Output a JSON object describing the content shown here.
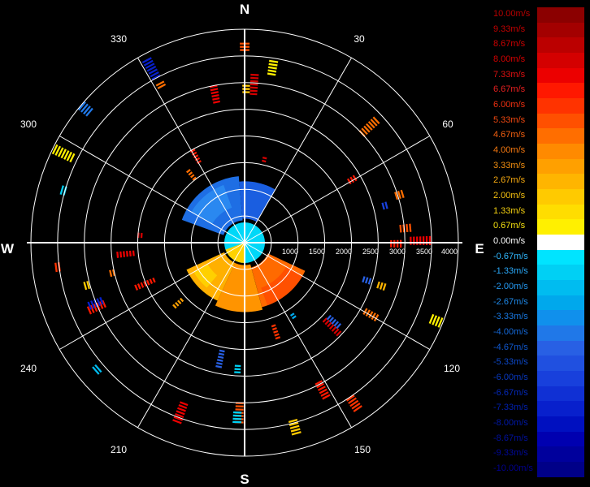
{
  "compass": {
    "north": "N",
    "south": "S",
    "east": "E",
    "west": "W"
  },
  "azimuth_labels": [
    "30",
    "60",
    "120",
    "150",
    "210",
    "240",
    "300",
    "330"
  ],
  "chart_data": {
    "type": "heatmap",
    "projection": "polar",
    "range_labels": [
      "1000",
      "1500",
      "2000",
      "2500",
      "3000",
      "3500",
      "4000"
    ],
    "range_max": 4000,
    "colorbar": {
      "labels": [
        "10.00m/s",
        "9.33m/s",
        "8.67m/s",
        "8.00m/s",
        "7.33m/s",
        "6.67m/s",
        "6.00m/s",
        "5.33m/s",
        "4.67m/s",
        "4.00m/s",
        "3.33m/s",
        "2.67m/s",
        "2.00m/s",
        "1.33m/s",
        "0.67m/s",
        "0.00m/s",
        "-0.67m/s",
        "-1.33m/s",
        "-2.00m/s",
        "-2.67m/s",
        "-3.33m/s",
        "-4.00m/s",
        "-4.67m/s",
        "-5.33m/s",
        "-6.00m/s",
        "-6.67m/s",
        "-7.33m/s",
        "-8.00m/s",
        "-8.67m/s",
        "-9.33m/s",
        "-10.00m/s"
      ],
      "colors": [
        "#8b0000",
        "#a30000",
        "#bb0000",
        "#d40000",
        "#ec0000",
        "#ff1800",
        "#ff3300",
        "#ff5000",
        "#ff6e00",
        "#ff8a00",
        "#ffa000",
        "#ffb500",
        "#ffca00",
        "#ffdd00",
        "#fff000",
        "#ffffff",
        "#00e4ff",
        "#00d0f4",
        "#00bcf0",
        "#00a8ec",
        "#1090ec",
        "#2078e8",
        "#2860e4",
        "#2050e0",
        "#1840dc",
        "#1030d4",
        "#0820cc",
        "#0010c0",
        "#0000b0",
        "#00009c",
        "#000088"
      ],
      "label_colors": [
        "#b80000",
        "#c20000",
        "#cc0000",
        "#d60000",
        "#e01010",
        "#e82020",
        "#f03010",
        "#f04810",
        "#f46010",
        "#f47810",
        "#f49010",
        "#f4a810",
        "#f4c010",
        "#f4d010",
        "#f4e010",
        "#ffffff",
        "#30b8ff",
        "#2aa8f8",
        "#2498f0",
        "#1e88e8",
        "#1878e0",
        "#1468d8",
        "#1058d0",
        "#0c48c8",
        "#0838c0",
        "#0428b8",
        "#0020b0",
        "#0018a8",
        "#0010a0",
        "#000898",
        "#000090"
      ]
    },
    "regions": [
      {
        "name": "inner-blue-sector",
        "az_from": 290,
        "az_to": 355,
        "r_from": 420,
        "r_to": 1250,
        "color": "#1e6ee4"
      },
      {
        "name": "inner-blue-sector-b",
        "az_from": 300,
        "az_to": 340,
        "r_from": 700,
        "r_to": 1150,
        "color": "#2a88f0"
      },
      {
        "name": "inner-blue-north",
        "az_from": 355,
        "az_to": 30,
        "r_from": 450,
        "r_to": 1150,
        "color": "#1a5ee0"
      },
      {
        "name": "center-disk",
        "az_from": 0,
        "az_to": 360,
        "r_from": 0,
        "r_to": 380,
        "color": "#00d8f8"
      },
      {
        "name": "center-yellow",
        "az_from": 180,
        "az_to": 250,
        "r_from": 0,
        "r_to": 380,
        "color": "#ffd200"
      },
      {
        "name": "orange-se",
        "az_from": 115,
        "az_to": 165,
        "r_from": 480,
        "r_to": 1250,
        "color": "#ff6a00"
      },
      {
        "name": "orange-se-outer",
        "az_from": 120,
        "az_to": 160,
        "r_from": 900,
        "r_to": 1250,
        "color": "#ff5000"
      },
      {
        "name": "orange-s",
        "az_from": 165,
        "az_to": 205,
        "r_from": 420,
        "r_to": 1300,
        "color": "#ff9400"
      },
      {
        "name": "yellow-sw",
        "az_from": 205,
        "az_to": 245,
        "r_from": 420,
        "r_to": 1200,
        "color": "#ffb000"
      },
      {
        "name": "yellow-sw-b",
        "az_from": 220,
        "az_to": 240,
        "r_from": 800,
        "r_to": 1100,
        "color": "#ffd000"
      }
    ]
  }
}
